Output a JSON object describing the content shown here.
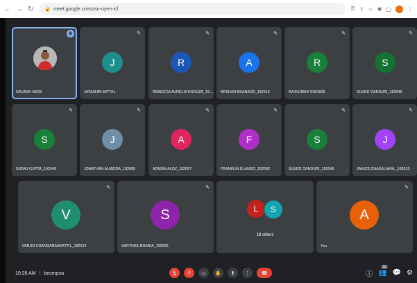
{
  "browser": {
    "url": "meet.google.com/zsn-oyen-icf",
    "nav_icons": [
      "back-icon",
      "forward-icon",
      "reload-icon"
    ],
    "toolbar_icons": [
      "key-icon",
      "share-icon",
      "star-icon",
      "extensions-icon",
      "tabs-icon"
    ]
  },
  "tiles": [
    {
      "name": "GAURAV MODI",
      "type": "photo"
    },
    {
      "name": "JAYASHRI MITTAL",
      "initial": "J",
      "color": "#1e8e8e"
    },
    {
      "name": "REBECCA AURELIA DSOUZA_19...",
      "initial": "R",
      "color": "#1a57b6"
    },
    {
      "name": "ARSHAN BHANAGE_192010",
      "initial": "A",
      "color": "#1a73e8"
    },
    {
      "name": "RAJKUMAR SHENDE",
      "initial": "R",
      "color": "#188038"
    },
    {
      "name": "SUVED GANDURI_192046",
      "initial": "S",
      "color": "#137333"
    },
    {
      "name": "SURAJ GUPTA_192049",
      "initial": "S",
      "color": "#188038"
    },
    {
      "name": "JONATHAN ALMEIDA_192005",
      "initial": "J",
      "color": "#6f8fa8"
    },
    {
      "name": "ADMON ALOZ_192007",
      "initial": "A",
      "color": "#e0245e"
    },
    {
      "name": "FRANKLIN ELANGO_192002",
      "initial": "F",
      "color": "#b02fc8"
    },
    {
      "name": "SUVED GANDURI_192046",
      "initial": "S",
      "color": "#188038"
    },
    {
      "name": "JANICE CHAKALAKAL_192013",
      "initial": "J",
      "color": "#a142f4"
    },
    {
      "name": "VARUN CHANGARANKATTIL_192014",
      "initial": "V",
      "color": "#1e8e6e"
    },
    {
      "name": "SARTHAK DHARIA_192026",
      "initial": "S",
      "color": "#8e24aa"
    },
    {
      "name": "18 others",
      "initials": [
        "L",
        "S"
      ],
      "colors": [
        "#c5221f",
        "#12a4af"
      ]
    },
    {
      "name": "You",
      "initial": "A",
      "color": "#e8600a"
    }
  ],
  "bottom": {
    "time": "10:26 AM",
    "separator": "|",
    "meeting_code": "becmpna",
    "participant_count": "18",
    "controls": [
      "mic-off-icon",
      "camera-off-icon",
      "captions-icon",
      "raise-hand-icon",
      "present-icon",
      "more-options-icon",
      "hang-up-icon"
    ],
    "right_icons": [
      "info-icon",
      "people-icon",
      "chat-icon",
      "activities-icon"
    ]
  }
}
